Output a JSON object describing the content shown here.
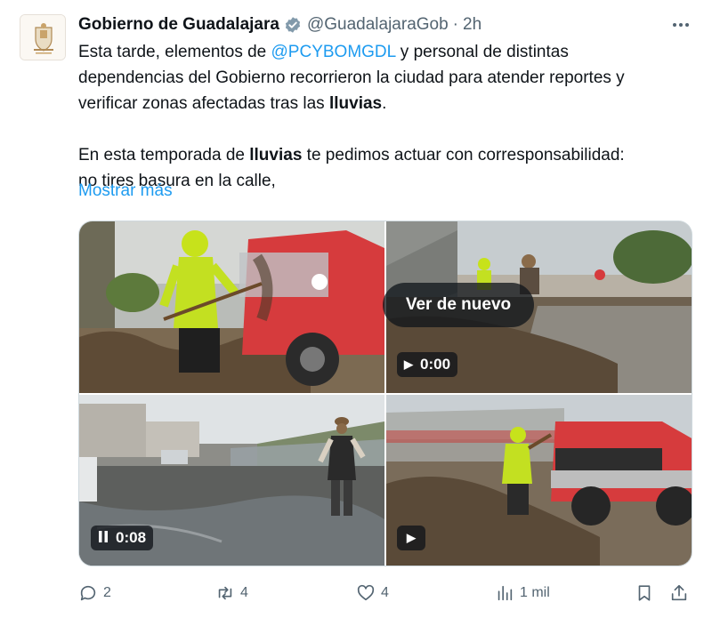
{
  "tweet": {
    "display_name": "Gobierno de Guadalajara",
    "handle": "@GuadalajaraGob",
    "separator": "·",
    "time": "2h",
    "avatar_icon": "city-seal-icon",
    "text": {
      "p1_a": "Esta tarde, elementos de ",
      "p1_mention": "@PCYBOMGDL",
      "p1_b": " y personal de distintas",
      "p1_line2": "dependencias del Gobierno recorrieron la ciudad para atender reportes y",
      "p1_line3_a": "verificar zonas afectadas tras las ",
      "p1_line3_bold": "lluvias",
      "p1_line3_end": ".",
      "p2_a": " En esta temporada de ",
      "p2_bold": "lluvias",
      "p2_b": " te pedimos actuar con corresponsabilidad:",
      "p2_line2": "no tires basura en la calle,"
    },
    "show_more": "Mostrar más"
  },
  "media": {
    "replay_label": "Ver de nuevo",
    "tile2_time": "0:00",
    "tile3_time": "0:08",
    "tile2_icon": "play-icon",
    "tile3_icon": "pause-icon",
    "tile4_icon": "play-icon"
  },
  "actions": {
    "replies": "2",
    "reposts": "4",
    "likes": "4",
    "views": "1 mil"
  },
  "colors": {
    "accent": "#1d9bf0",
    "secondary_text": "#536471",
    "verified_badge": "#829aab"
  }
}
